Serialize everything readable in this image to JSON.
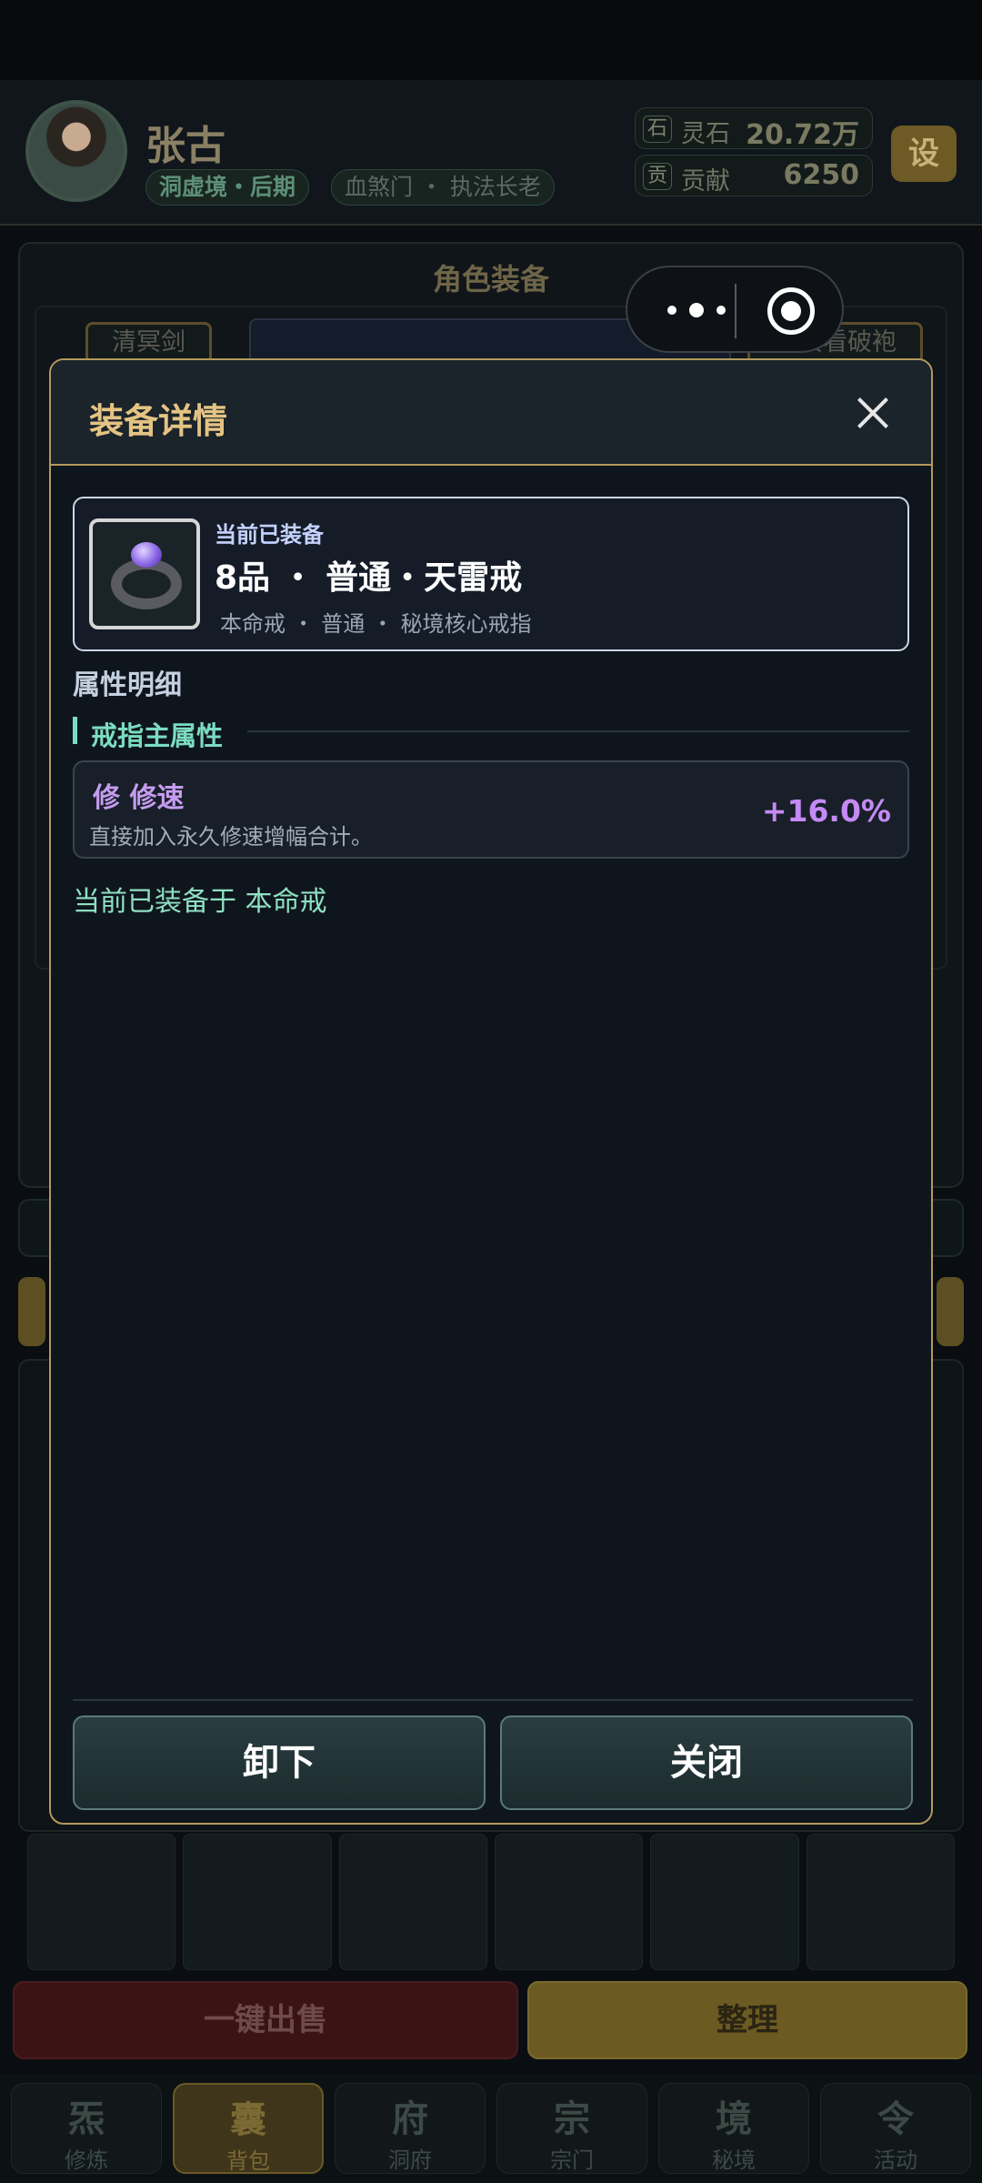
{
  "header": {
    "name": "张古",
    "tag_realm": "洞虚境・后期",
    "tag_sect": "血煞门 ・ 执法长老",
    "resources": [
      {
        "icon": "石",
        "label": "灵石",
        "value": "20.72万"
      },
      {
        "icon": "贡",
        "label": "贡献",
        "value": "6250"
      }
    ],
    "settings_label": "设"
  },
  "panel": {
    "title": "角色装备",
    "left_slot": "清冥剑",
    "right_slot": "清冥看破袍"
  },
  "modal": {
    "title": "装备详情",
    "item": {
      "equipped_label": "当前已装备",
      "name": "8品 ・ 普通・天雷戒",
      "subtitle": "本命戒 ・ 普通 ・ 秘境核心戒指"
    },
    "section_title": "属性明细",
    "sub_section_title": "戒指主属性",
    "stat": {
      "name": "修  修速",
      "description": "直接加入永久修速增幅合计。",
      "value": "+16.0%"
    },
    "equipped_note": "当前已装备于 本命戒",
    "buttons": {
      "unequip": "卸下",
      "close": "关闭"
    }
  },
  "bottom_actions": {
    "sell_all": "一键出售",
    "sort": "整理"
  },
  "tabbar": [
    {
      "glyph": "炁",
      "label": "修炼",
      "active": false
    },
    {
      "glyph": "囊",
      "label": "背包",
      "active": true
    },
    {
      "glyph": "府",
      "label": "洞府",
      "active": false
    },
    {
      "glyph": "宗",
      "label": "宗门",
      "active": false
    },
    {
      "glyph": "境",
      "label": "秘境",
      "active": false
    },
    {
      "glyph": "令",
      "label": "活动",
      "active": false
    }
  ],
  "colors": {
    "accent_gold": "#e4c483",
    "stat_purple": "#c58af6",
    "note_green": "#8ee0c2"
  }
}
